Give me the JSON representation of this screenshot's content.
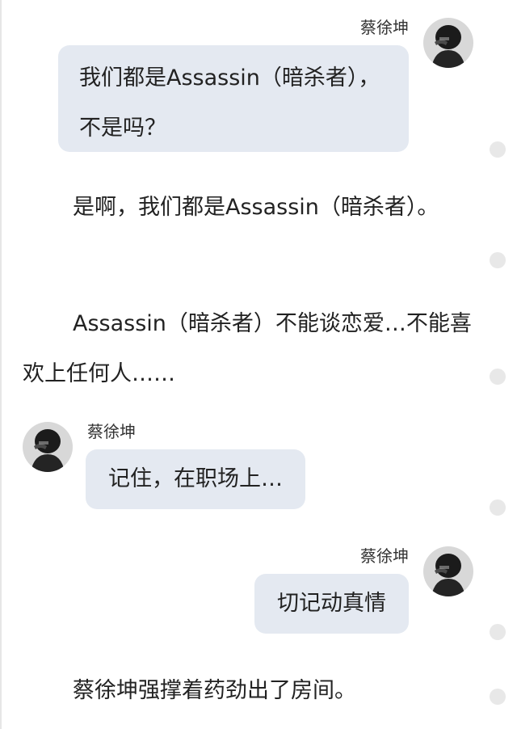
{
  "messages": [
    {
      "kind": "right",
      "name": "蔡徐坤",
      "text": "我们都是Assassin（暗杀者），不是吗？"
    },
    {
      "kind": "narration",
      "text": "是啊，我们都是Assassin（暗杀者）。"
    },
    {
      "kind": "narration",
      "text": "Assassin（暗杀者）不能谈恋爱…不能喜欢上任何人……"
    },
    {
      "kind": "left",
      "name": "蔡徐坤",
      "text": "记住，在职场上…"
    },
    {
      "kind": "right",
      "name": "蔡徐坤",
      "text": "切记动真情"
    },
    {
      "kind": "narration",
      "text": "蔡徐坤强撑着药劲出了房间。"
    }
  ],
  "colors": {
    "bubble": "#e4e9f1",
    "dot": "#e8e8e8",
    "text": "#222222"
  },
  "icons": {
    "avatar": "dark-portrait-avatar",
    "side_marker": "gray-dot-icon"
  }
}
